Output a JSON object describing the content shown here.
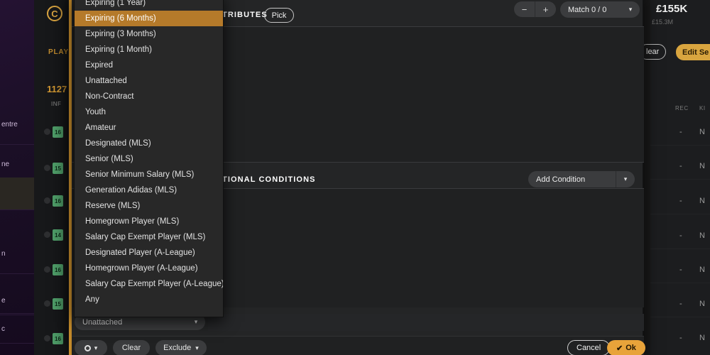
{
  "background": {
    "logo_glyph": "C",
    "players_label": "PLAY",
    "count_label": "1127",
    "inf_label": "INF",
    "purple_rows": [
      {
        "label": "entre"
      },
      {
        "label": "ne"
      },
      {
        "label": ""
      },
      {
        "label": "n"
      },
      {
        "label": ""
      },
      {
        "label": "e"
      },
      {
        "label": "c"
      }
    ],
    "green_chips": [
      "16",
      "15",
      "16",
      "14",
      "16",
      "15",
      "16"
    ],
    "right_panel": {
      "money": "£155K",
      "money_sub": "£15.3M",
      "clear_label": "lear",
      "edit_label": "Edit Se",
      "col_rec": "REC",
      "col_k": "KI",
      "rec_values": [
        "-",
        "-",
        "-",
        "-",
        "-",
        "-",
        "-"
      ],
      "k_values": [
        "N",
        "N",
        "N",
        "N",
        "N",
        "N",
        "N"
      ]
    }
  },
  "modal": {
    "attributes_section": "TRIBUTES",
    "pick_label": "Pick",
    "stepper": {
      "minus": "−",
      "plus": "+"
    },
    "match_combo": {
      "value": "Match 0 / 0",
      "caret": "▾"
    },
    "conditions_section": "TIONAL CONDITIONS",
    "add_condition": {
      "value": "Add Condition",
      "caret": "▾"
    },
    "status_combo": {
      "value": "Unattached",
      "caret": "▾"
    },
    "footer": {
      "gear_caret": "▾",
      "clear_label": "Clear",
      "exclude_label": "Exclude",
      "exclude_caret": "▾",
      "cancel_label": "Cancel",
      "ok_label": "Ok",
      "ok_check": "✔"
    }
  },
  "dropdown": {
    "selected_index": 1,
    "items": [
      {
        "label": "Expiring (1 Year)"
      },
      {
        "label": "Expiring (6 Months)"
      },
      {
        "label": "Expiring (3 Months)"
      },
      {
        "label": "Expiring (1 Month)"
      },
      {
        "label": "Expired"
      },
      {
        "label": "Unattached"
      },
      {
        "label": "Non-Contract"
      },
      {
        "label": "Youth"
      },
      {
        "label": "Amateur"
      },
      {
        "label": "Designated (MLS)"
      },
      {
        "label": "Senior (MLS)"
      },
      {
        "label": "Senior Minimum Salary (MLS)"
      },
      {
        "label": "Generation Adidas (MLS)"
      },
      {
        "label": "Reserve (MLS)"
      },
      {
        "label": "Homegrown Player (MLS)"
      },
      {
        "label": "Salary Cap Exempt Player (MLS)"
      },
      {
        "label": "Designated Player (A-League)"
      },
      {
        "label": "Homegrown Player (A-League)"
      },
      {
        "label": "Salary Cap Exempt Player (A-League)"
      },
      {
        "label": "Any"
      }
    ]
  },
  "colors": {
    "accent_amber": "#d9a53f",
    "highlight_brown": "#b57a2a",
    "modal_bg": "#242526",
    "dropdown_bg": "#282828"
  }
}
